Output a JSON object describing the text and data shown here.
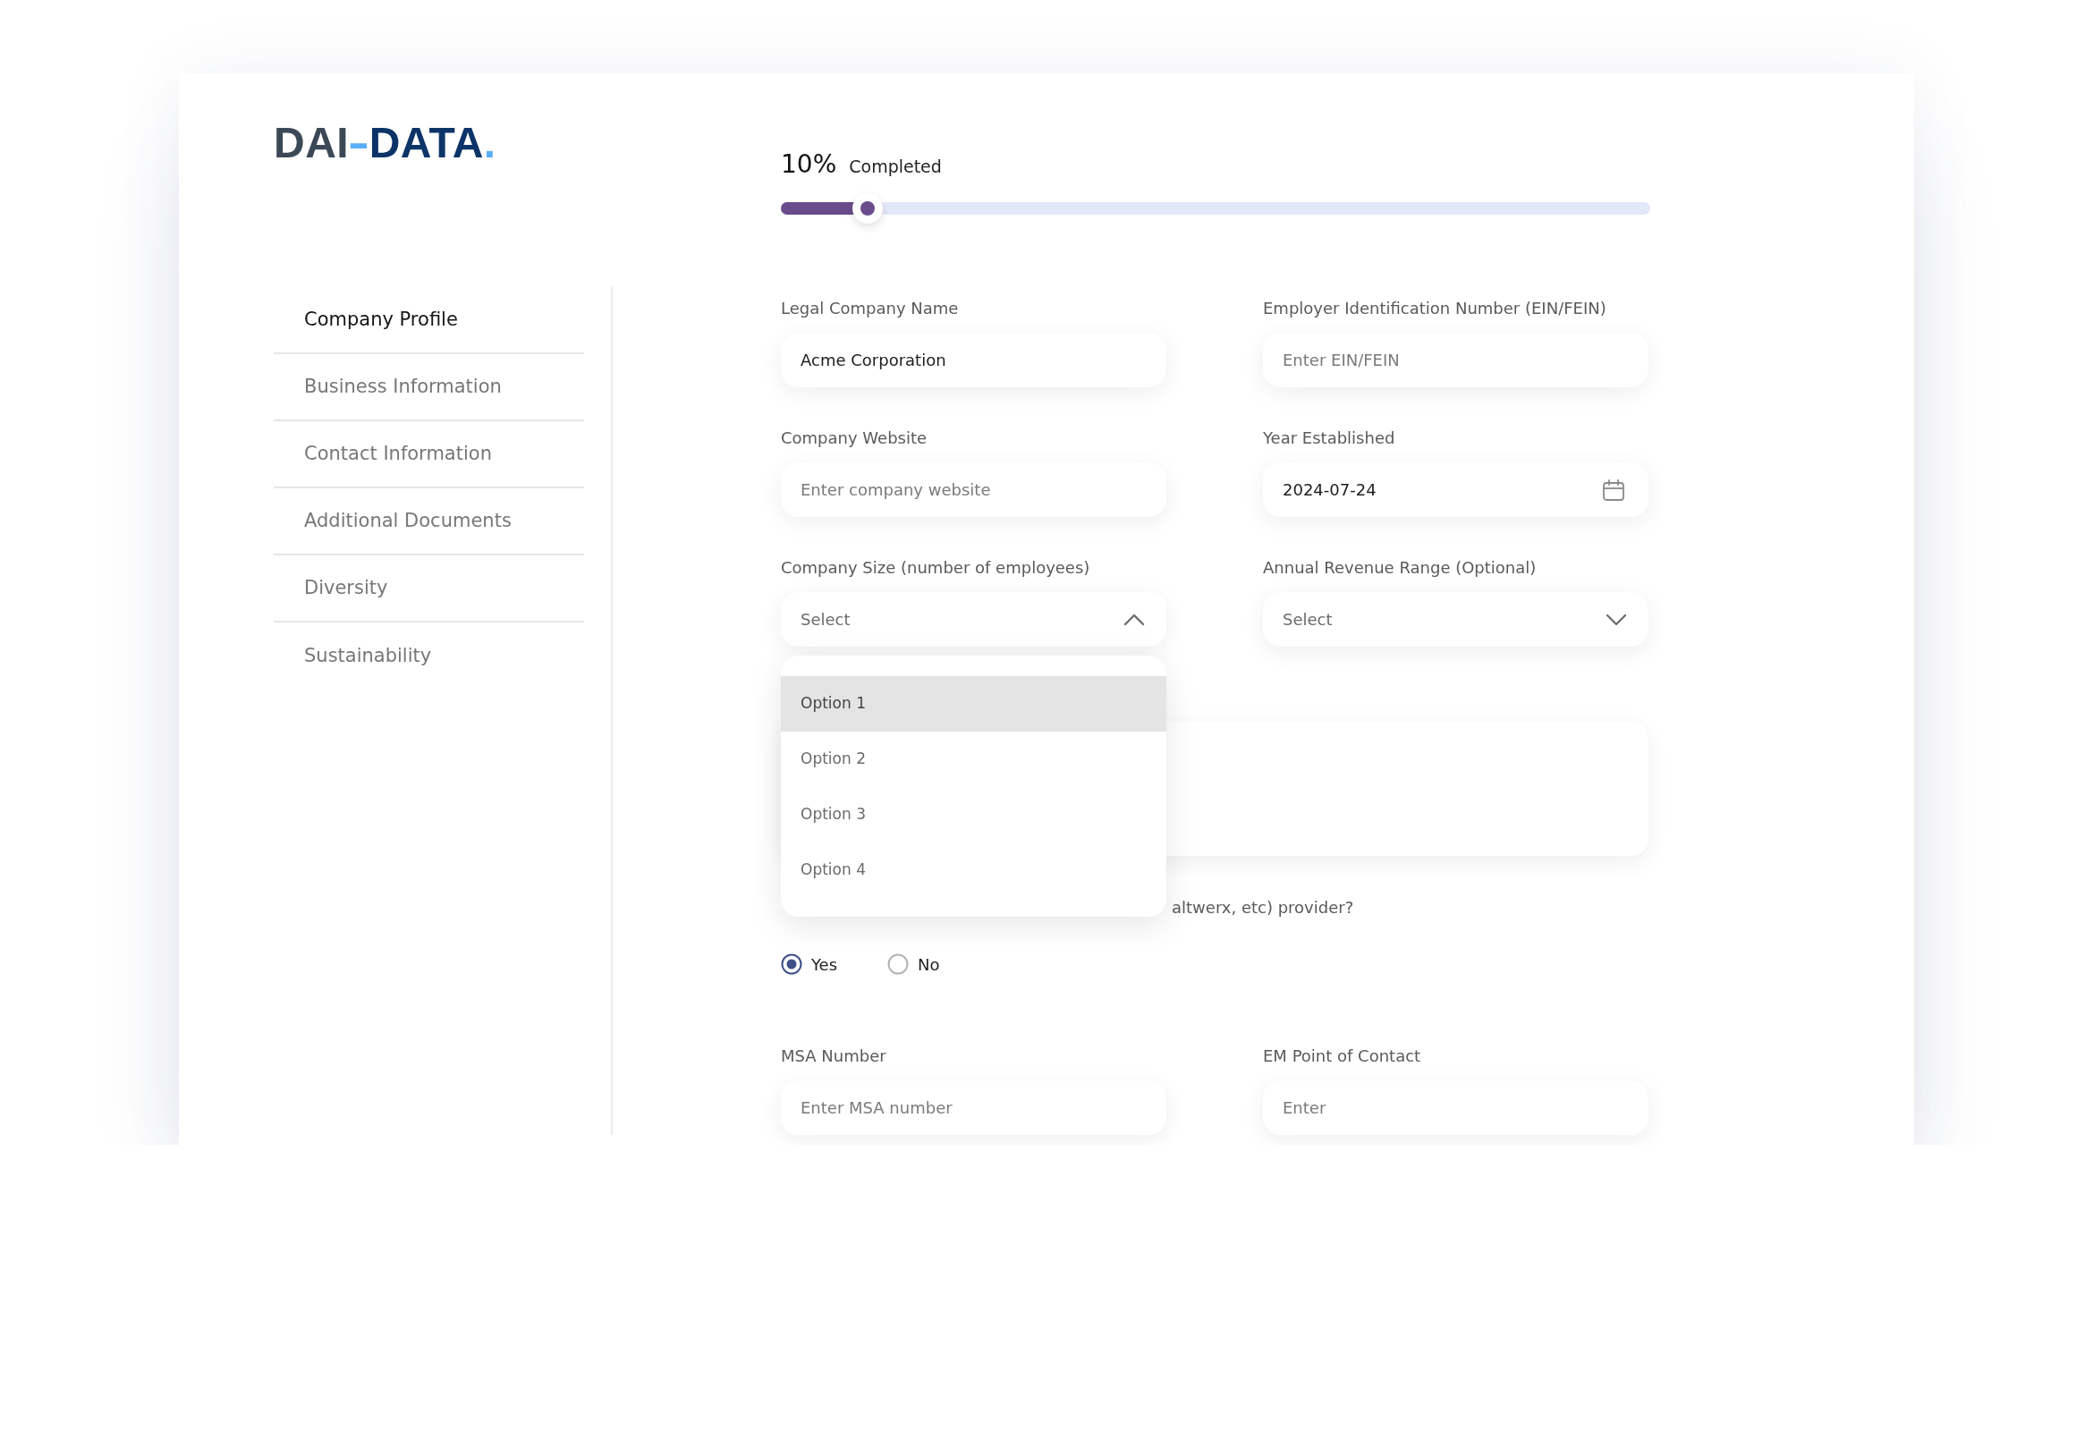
{
  "logo": {
    "parts": [
      {
        "text": "DAI",
        "color": "#3b4956"
      },
      {
        "text": "-",
        "color": "#5aaef7"
      },
      {
        "text": "DATA",
        "color": "#0d3468"
      },
      {
        "text": ".",
        "color": "#5aaef7"
      }
    ]
  },
  "progress": {
    "percent": "10%",
    "caption": "Completed",
    "level": 0.1
  },
  "sidebar": {
    "items": [
      {
        "label": "Company Profile",
        "selected": true
      },
      {
        "label": "Business Information",
        "selected": false
      },
      {
        "label": "Contact Information",
        "selected": false
      },
      {
        "label": "Additional Documents",
        "selected": false
      },
      {
        "label": "Diversity",
        "selected": false
      },
      {
        "label": "Sustainability",
        "selected": false
      }
    ]
  },
  "form": {
    "fields": [
      {
        "kind": "text",
        "label": "Legal Company Name",
        "value": "Acme Corporation"
      },
      {
        "kind": "text",
        "label": "Employer Identification Number (EIN/FEIN)",
        "placeholder": "Enter EIN/FEIN"
      },
      {
        "kind": "text",
        "label": "Company Website",
        "placeholder": "Enter company website"
      },
      {
        "kind": "date",
        "label": "Year Established",
        "value": "2024-07-24"
      },
      {
        "kind": "select",
        "label": "Company Size (number of employees)",
        "placeholder": "Select",
        "expanded": true,
        "options": [
          {
            "label": "Option 1",
            "selected": true
          },
          {
            "label": "Option 2",
            "selected": false
          },
          {
            "label": "Option 3",
            "selected": false
          },
          {
            "label": "Option 4",
            "selected": false
          }
        ]
      },
      {
        "kind": "select",
        "label": "Annual Revenue Range (Optional)",
        "placeholder": "Select",
        "expanded": false
      },
      {
        "kind": "textarea"
      },
      {
        "kind": "question",
        "text": "altwerx, etc) provider?",
        "options": [
          {
            "label": "Yes",
            "selected": true
          },
          {
            "label": "No",
            "selected": false
          }
        ]
      },
      {
        "kind": "text",
        "label": "MSA Number",
        "placeholder": "Enter MSA number"
      },
      {
        "kind": "text",
        "label": "EM Point of Contact",
        "placeholder": "Enter"
      }
    ]
  }
}
